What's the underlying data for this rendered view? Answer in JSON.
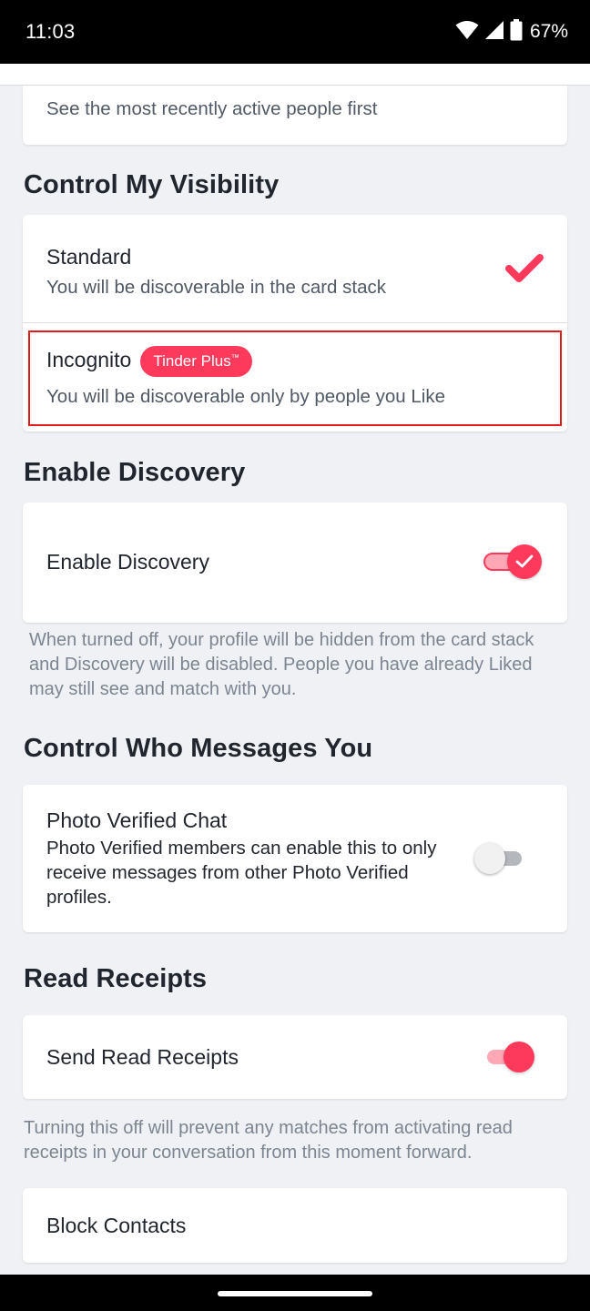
{
  "status_bar": {
    "time": "11:03",
    "battery": "67%"
  },
  "recently_active": {
    "subtitle": "See the most recently active people first"
  },
  "visibility": {
    "title": "Control My Visibility",
    "standard": {
      "label": "Standard",
      "subtitle": "You will be discoverable in the card stack",
      "selected": true
    },
    "incognito": {
      "label": "Incognito",
      "badge": "Tinder Plus",
      "badge_mark": "™",
      "subtitle": "You will be discoverable only by people you Like",
      "selected": false
    }
  },
  "discovery": {
    "title": "Enable Discovery",
    "toggle_label": "Enable Discovery",
    "enabled": true,
    "helper": "When turned off, your profile will be hidden from the card stack and Discovery will be disabled. People you have already Liked may still see and match with you."
  },
  "messages": {
    "title": "Control Who Messages You",
    "photo_verified": {
      "label": "Photo Verified Chat",
      "subtitle": "Photo Verified members can enable this to only receive messages from other Photo Verified profiles.",
      "enabled": false
    }
  },
  "read_receipts": {
    "title": "Read Receipts",
    "toggle_label": "Send Read Receipts",
    "enabled": true,
    "helper": "Turning this off will prevent any matches from activating read receipts in your conversation from this moment forward."
  },
  "block_contacts": {
    "label": "Block Contacts"
  },
  "colors": {
    "accent": "#fd3a5c",
    "highlight": "#e41b1b",
    "background": "#eff1f4"
  },
  "icons": [
    "wifi-icon",
    "signal-icon",
    "battery-icon",
    "check-icon",
    "toggle-check-icon"
  ]
}
